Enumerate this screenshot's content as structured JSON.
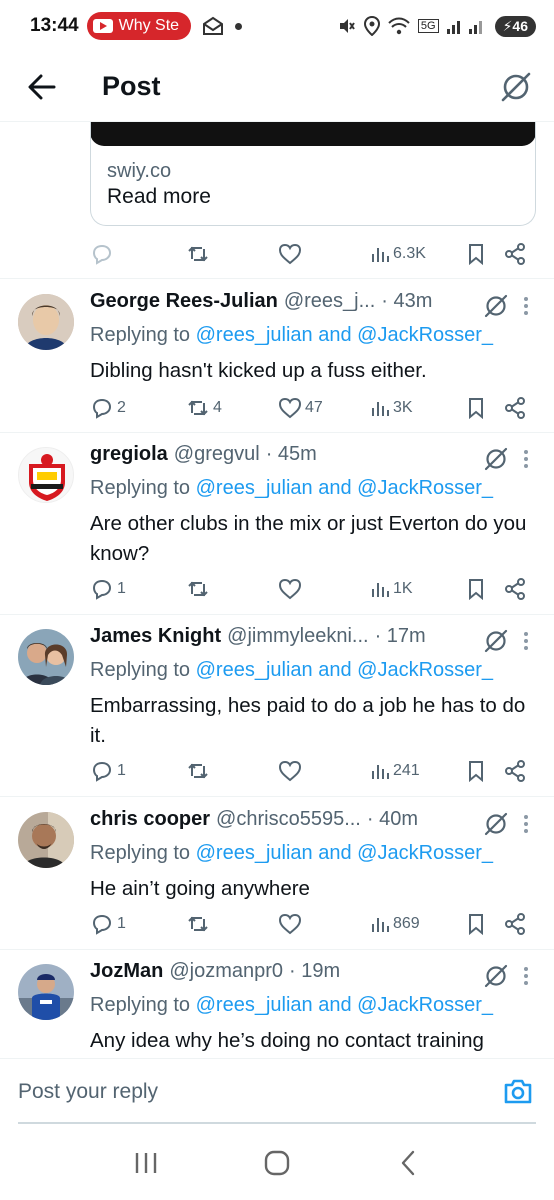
{
  "status_bar": {
    "time": "13:44",
    "notification_pill": "Why Ste",
    "network": "5G",
    "battery": "46"
  },
  "header": {
    "title": "Post"
  },
  "link_card": {
    "domain": "swiy.co",
    "read_more": "Read more"
  },
  "main_post_actions": {
    "views": "6.3K"
  },
  "replies": [
    {
      "name": "George Rees-Julian",
      "handle": "@rees_j...",
      "time": "· 43m",
      "replying_prefix": "Replying to ",
      "replying_to": "@rees_julian and @JackRosser_",
      "text": "Dibling hasn't kicked up a fuss either.",
      "replies": "2",
      "reposts": "4",
      "likes": "47",
      "views": "3K"
    },
    {
      "name": "gregiola",
      "handle": "@gregvul",
      "time": "· 45m",
      "replying_prefix": "Replying to ",
      "replying_to": "@rees_julian and @JackRosser_",
      "text": "Are other clubs in the mix or just Everton do you know?",
      "replies": "1",
      "reposts": "",
      "likes": "",
      "views": "1K"
    },
    {
      "name": "James Knight",
      "handle": "@jimmyleekni...",
      "time": "· 17m",
      "replying_prefix": "Replying to ",
      "replying_to": "@rees_julian and @JackRosser_",
      "text": "Embarrassing, hes paid to do a job he has to do it.",
      "replies": "1",
      "reposts": "",
      "likes": "",
      "views": "241"
    },
    {
      "name": "chris cooper",
      "handle": "@chrisco5595...",
      "time": "· 40m",
      "replying_prefix": "Replying to ",
      "replying_to": "@rees_julian and @JackRosser_",
      "text": "He ain’t going anywhere",
      "replies": "1",
      "reposts": "",
      "likes": "",
      "views": "869"
    },
    {
      "name": "JozMan",
      "handle": "@jozmanpr0",
      "time": "· 19m",
      "replying_prefix": "Replying to ",
      "replying_to": "@rees_julian and @JackRosser_",
      "text": "Any idea why he’s doing no contact training"
    }
  ],
  "compose": {
    "placeholder": "Post your reply"
  },
  "colors": {
    "accent": "#1d9bf0",
    "secondary_text": "#536471",
    "divider": "#eff3f4"
  }
}
